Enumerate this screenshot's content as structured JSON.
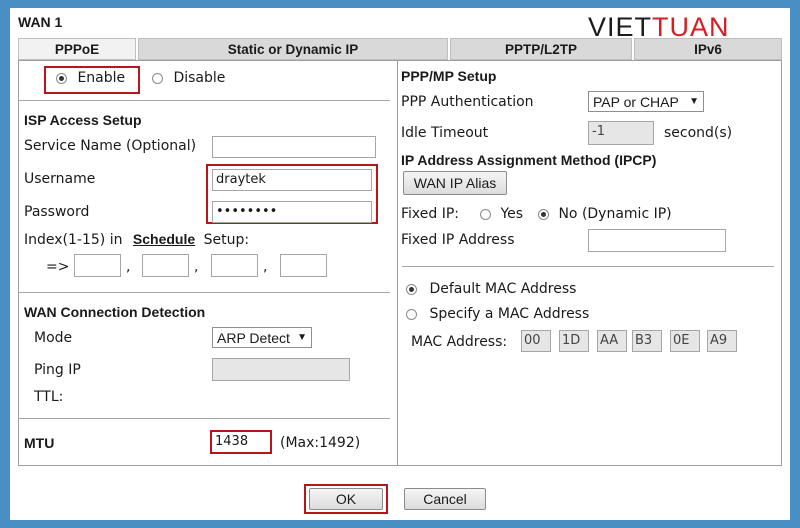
{
  "header": {
    "title": "WAN 1",
    "logo_prefix": "VIET",
    "logo_accent": "TUAN"
  },
  "tabs": [
    {
      "label": "PPPoE",
      "active": true
    },
    {
      "label": "Static or Dynamic IP",
      "active": false
    },
    {
      "label": "PPTP/L2TP",
      "active": false
    },
    {
      "label": "IPv6",
      "active": false
    }
  ],
  "enable": {
    "enable_label": "Enable",
    "disable_label": "Disable",
    "selected": "Enable"
  },
  "isp": {
    "title": "ISP Access Setup",
    "service_name_label": "Service Name (Optional)",
    "service_name_value": "",
    "username_label": "Username",
    "username_value": "draytek",
    "password_label": "Password",
    "password_value": "••••••••",
    "index_label": "Index(1-15) in",
    "schedule_link": "Schedule",
    "setup_label": "Setup:",
    "arrow": "=>",
    "comma": ","
  },
  "detection": {
    "title": "WAN Connection Detection",
    "mode_label": "Mode",
    "mode_value": "ARP Detect",
    "ping_ip_label": "Ping IP",
    "ttl_label": "TTL:"
  },
  "mtu": {
    "label": "MTU",
    "value": "1438",
    "max_note": "(Max:1492)"
  },
  "ppp": {
    "title": "PPP/MP Setup",
    "auth_label": "PPP Authentication",
    "auth_value": "PAP or CHAP",
    "idle_label": "Idle Timeout",
    "idle_value": "-1",
    "idle_unit": "second(s)"
  },
  "ipcp": {
    "title": "IP Address Assignment Method (IPCP)",
    "alias_button": "WAN IP Alias",
    "fixed_ip_label": "Fixed IP:",
    "yes_label": "Yes",
    "no_label": "No (Dynamic IP)",
    "fixed_ip_selected": "No",
    "fixed_ip_address_label": "Fixed IP Address"
  },
  "mac": {
    "default_label": "Default MAC Address",
    "specify_label": "Specify a MAC Address",
    "selected": "Default",
    "address_label": "MAC Address:",
    "octets": [
      "00",
      "1D",
      "AA",
      "B3",
      "0E",
      "A9"
    ]
  },
  "actions": {
    "ok_label": "OK",
    "cancel_label": "Cancel"
  },
  "colors": {
    "highlight": "#b8141c",
    "background": "#4a8fc4",
    "logo_accent": "#d81c23"
  }
}
